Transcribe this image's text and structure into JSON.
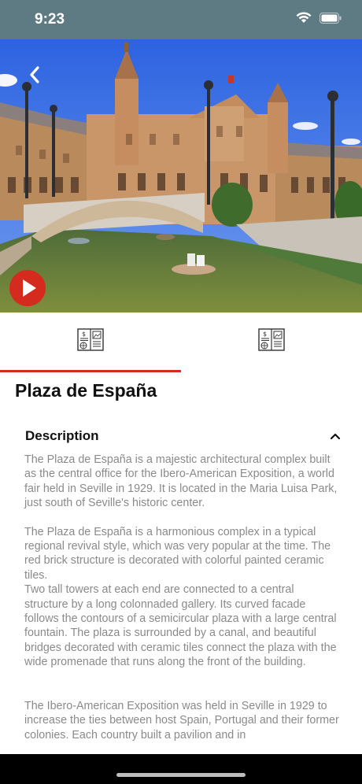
{
  "status_bar": {
    "time": "9:23",
    "icons": [
      "wifi-icon",
      "battery-icon"
    ]
  },
  "hero": {
    "image_subject": "Plaza de España",
    "back_icon": "chevron-left-icon",
    "play_icon": "play-icon",
    "play_color": "#d42b1e"
  },
  "tabs": [
    {
      "icon": "brochure-icon",
      "active": true
    },
    {
      "icon": "brochure-icon",
      "active": false
    }
  ],
  "accent_color": "#d42b1e",
  "place": {
    "title": "Plaza de España"
  },
  "description": {
    "title": "Description",
    "expanded": true,
    "paragraphs": [
      "The Plaza de España is a majestic architectural complex built as the central office for the Ibero-American Exposition, a world fair held in Seville in 1929. It is located in the Maria Luisa Park, just south of Seville's historic center.",
      "The Plaza de España is a harmonious complex in a typical regional revival style, which was very popular at the time. The red brick structure is decorated with colorful painted ceramic tiles.",
      "Two tall towers at each end are connected to a central structure by a long colonnaded gallery. Its curved facade follows the contours of a semicircular plaza with a large central fountain. The plaza is surrounded by a canal, and beautiful bridges decorated with ceramic tiles connect the plaza with the wide promenade that runs along the front of the building.",
      "The Ibero-American Exposition was held in Seville in 1929 to increase the ties between host Spain, Portugal and their former colonies. Each country built a pavilion and in"
    ]
  }
}
